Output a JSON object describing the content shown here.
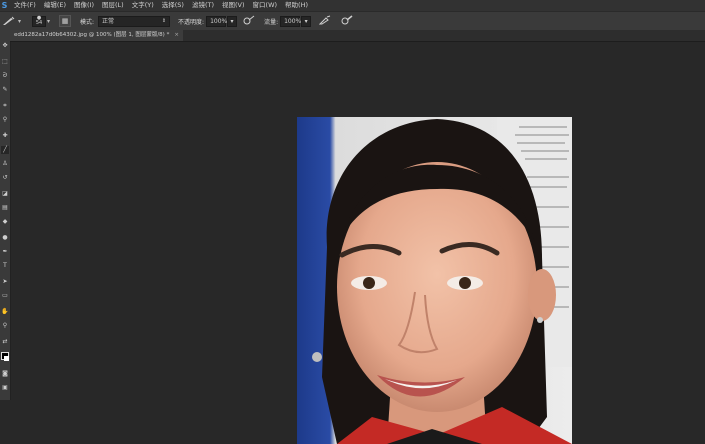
{
  "menu": {
    "items": [
      "文件(F)",
      "编辑(E)",
      "图像(I)",
      "图层(L)",
      "文字(Y)",
      "选择(S)",
      "滤镜(T)",
      "视图(V)",
      "窗口(W)",
      "帮助(H)"
    ]
  },
  "options": {
    "brush_size": "54",
    "mode_label": "模式:",
    "mode_value": "正常",
    "opacity_label": "不透明度:",
    "opacity_value": "100%",
    "flow_label": "流量:",
    "flow_value": "100%"
  },
  "document": {
    "tab_title": "edd1282a17d0b64302.jpg @ 100% (图层 1, 图层蒙版/8) *",
    "close": "×"
  },
  "colors": {
    "app_bg": "#282828",
    "panel": "#3a3a3a",
    "accent": "#4b9be6"
  }
}
